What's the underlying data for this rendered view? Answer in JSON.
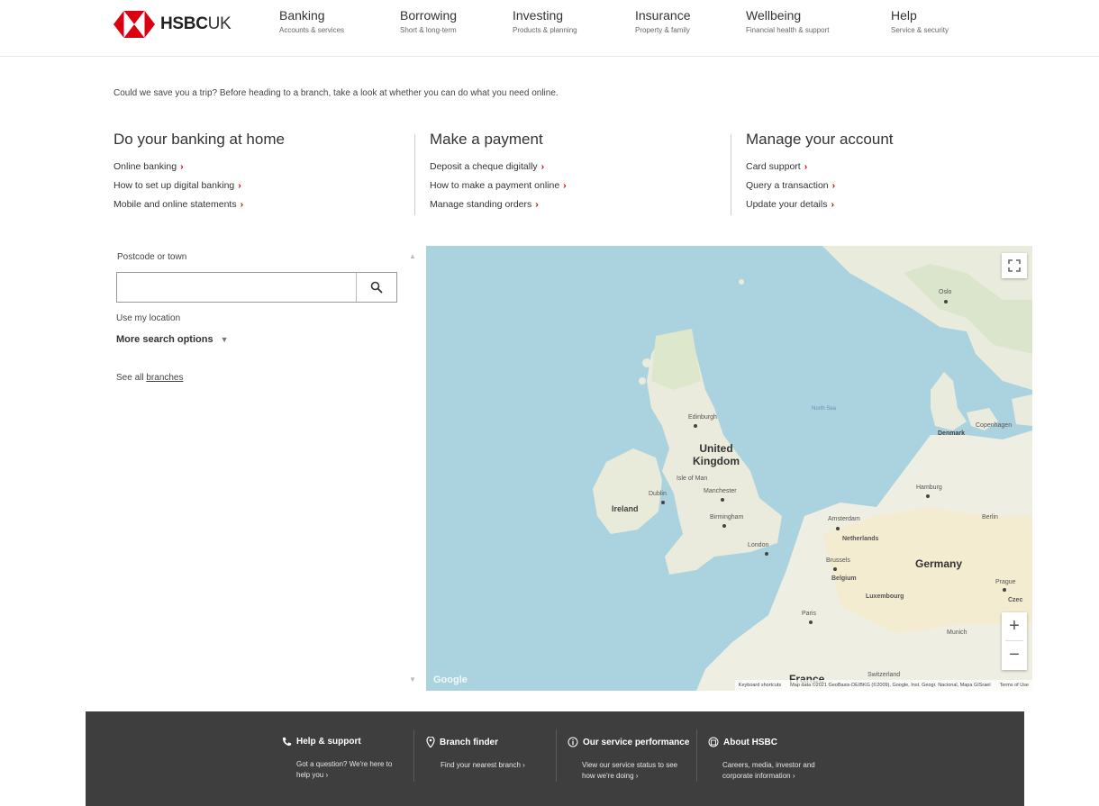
{
  "brand": {
    "name": "HSBC",
    "suffix": "UK",
    "color": "#db0011"
  },
  "nav": [
    {
      "title": "Banking",
      "sub": "Accounts & services"
    },
    {
      "title": "Borrowing",
      "sub": "Short & long-term"
    },
    {
      "title": "Investing",
      "sub": "Products & planning"
    },
    {
      "title": "Insurance",
      "sub": "Property & family"
    },
    {
      "title": "Wellbeing",
      "sub": "Financial health & support"
    },
    {
      "title": "Help",
      "sub": "Service & security"
    }
  ],
  "intro": "Could we save you a trip? Before heading to a branch, take a look at whether you can do what you need online.",
  "columns": [
    {
      "heading": "Do your banking at home",
      "links": [
        "Online banking",
        "How to set up digital banking",
        "Mobile and online statements"
      ]
    },
    {
      "heading": "Make a payment",
      "links": [
        "Deposit a cheque digitally",
        "How to make a payment online",
        "Manage standing orders"
      ]
    },
    {
      "heading": "Manage your account",
      "links": [
        "Card support",
        "Query a transaction",
        "Update your details"
      ]
    }
  ],
  "search": {
    "label": "Postcode or town",
    "value": "",
    "placeholder": "",
    "use_location": "Use my location",
    "more_options": "More search options",
    "see_all_prefix": "See all ",
    "see_all_link": "branches"
  },
  "map": {
    "labels": {
      "uk_line1": "United",
      "uk_line2": "Kingdom",
      "ireland": "Ireland",
      "dublin": "Dublin",
      "isle_of_man": "Isle of Man",
      "edinburgh": "Edinburgh",
      "manchester": "Manchester",
      "birmingham": "Birmingham",
      "london": "London",
      "north_sea": "North Sea",
      "oslo": "Oslo",
      "denmark": "Denmark",
      "copenhagen": "Copenhagen",
      "hamburg": "Hamburg",
      "berlin": "Berlin",
      "amsterdam": "Amsterdam",
      "netherlands": "Netherlands",
      "brussels": "Brussels",
      "belgium": "Belgium",
      "luxembourg": "Luxembourg",
      "germany": "Germany",
      "prague": "Prague",
      "czech": "Czec",
      "paris": "Paris",
      "munich": "Munich",
      "france": "France",
      "switzerland": "Switzerland"
    },
    "google": "Google",
    "attribution": {
      "shortcuts": "Keyboard shortcuts",
      "data": "Map data ©2021 GeoBasis-DE/BKG (©2009), Google, Inst. Geogr. Nacional, Mapa GISrael",
      "terms": "Terms of Use"
    },
    "zoom_in": "+",
    "zoom_out": "−"
  },
  "footer": [
    {
      "title": "Help & support",
      "text": "Got a question? We're here to help you ›",
      "icon": "phone-icon"
    },
    {
      "title": "Branch finder",
      "text": "Find your nearest branch ›",
      "icon": "location-pin-icon"
    },
    {
      "title": "Our service performance",
      "text": "View our service status to see how we're doing ›",
      "icon": "info-icon"
    },
    {
      "title": "About HSBC",
      "text": "Careers, media, investor and corporate information ›",
      "icon": "building-icon"
    }
  ]
}
